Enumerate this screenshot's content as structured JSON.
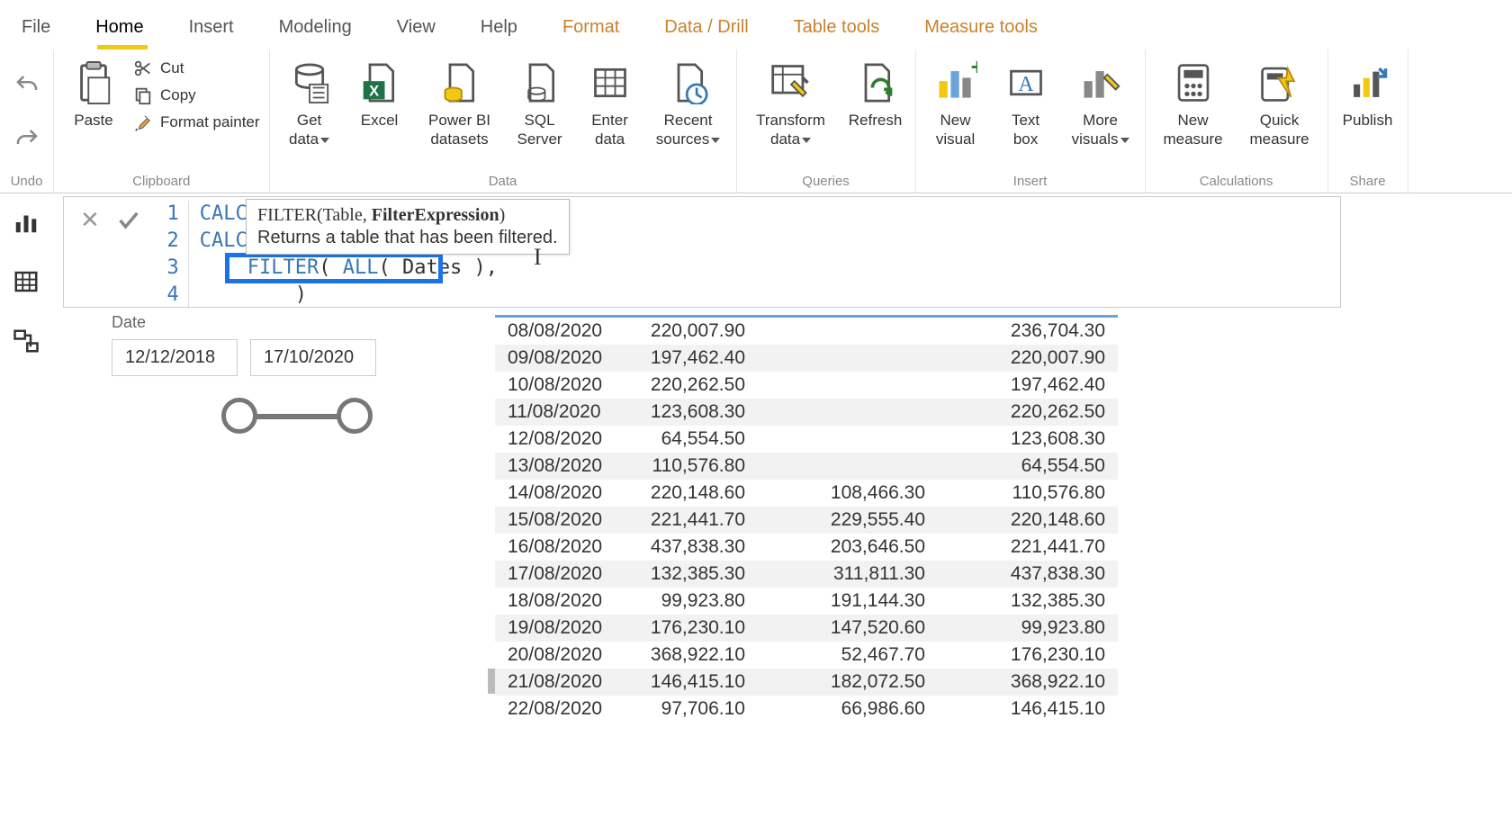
{
  "ribbon": {
    "tabs": [
      "File",
      "Home",
      "Insert",
      "Modeling",
      "View",
      "Help",
      "Format",
      "Data / Drill",
      "Table tools",
      "Measure tools"
    ],
    "active_tab": "Home",
    "groups": {
      "undo": "Undo",
      "clipboard": {
        "label": "Clipboard",
        "paste": "Paste",
        "cut": "Cut",
        "copy": "Copy",
        "format_painter": "Format painter"
      },
      "data": {
        "label": "Data",
        "get_data": "Get\ndata",
        "excel": "Excel",
        "pbi_datasets": "Power BI\ndatasets",
        "sql_server": "SQL\nServer",
        "enter_data": "Enter\ndata",
        "recent_sources": "Recent\nsources"
      },
      "queries": {
        "label": "Queries",
        "transform": "Transform\ndata",
        "refresh": "Refresh"
      },
      "insert": {
        "label": "Insert",
        "new_visual": "New\nvisual",
        "text_box": "Text\nbox",
        "more_visuals": "More\nvisuals"
      },
      "calculations": {
        "label": "Calculations",
        "new_measure": "New\nmeasure",
        "quick_measure": "Quick\nmeasure"
      },
      "share": {
        "label": "Share",
        "publish": "Publish"
      }
    }
  },
  "formula": {
    "lines": {
      "l1": "CALC",
      "l2": "CALC",
      "l3_pre": "    ",
      "l3_func": "FILTER",
      "l3_open": "( ",
      "l3_all": "ALL",
      "l3_args": "( Dates ),",
      "l4": "        )"
    },
    "gutter": [
      "1",
      "2",
      "3",
      "4"
    ]
  },
  "tooltip": {
    "sig_fn": "FILTER",
    "sig_open": "(Table, ",
    "sig_param": "FilterExpression",
    "sig_close": ")",
    "desc": "Returns a table that has been filtered."
  },
  "slicer": {
    "title": "Date",
    "from": "12/12/2018",
    "to": "17/10/2020"
  },
  "table": {
    "rows": [
      {
        "date": "08/08/2020",
        "v1": "220,007.90",
        "v2": "",
        "v3": "236,704.30"
      },
      {
        "date": "09/08/2020",
        "v1": "197,462.40",
        "v2": "",
        "v3": "220,007.90"
      },
      {
        "date": "10/08/2020",
        "v1": "220,262.50",
        "v2": "",
        "v3": "197,462.40"
      },
      {
        "date": "11/08/2020",
        "v1": "123,608.30",
        "v2": "",
        "v3": "220,262.50"
      },
      {
        "date": "12/08/2020",
        "v1": "64,554.50",
        "v2": "",
        "v3": "123,608.30"
      },
      {
        "date": "13/08/2020",
        "v1": "110,576.80",
        "v2": "",
        "v3": "64,554.50"
      },
      {
        "date": "14/08/2020",
        "v1": "220,148.60",
        "v2": "108,466.30",
        "v3": "110,576.80"
      },
      {
        "date": "15/08/2020",
        "v1": "221,441.70",
        "v2": "229,555.40",
        "v3": "220,148.60"
      },
      {
        "date": "16/08/2020",
        "v1": "437,838.30",
        "v2": "203,646.50",
        "v3": "221,441.70"
      },
      {
        "date": "17/08/2020",
        "v1": "132,385.30",
        "v2": "311,811.30",
        "v3": "437,838.30"
      },
      {
        "date": "18/08/2020",
        "v1": "99,923.80",
        "v2": "191,144.30",
        "v3": "132,385.30"
      },
      {
        "date": "19/08/2020",
        "v1": "176,230.10",
        "v2": "147,520.60",
        "v3": "99,923.80"
      },
      {
        "date": "20/08/2020",
        "v1": "368,922.10",
        "v2": "52,467.70",
        "v3": "176,230.10"
      },
      {
        "date": "21/08/2020",
        "v1": "146,415.10",
        "v2": "182,072.50",
        "v3": "368,922.10"
      },
      {
        "date": "22/08/2020",
        "v1": "97,706.10",
        "v2": "66,986.60",
        "v3": "146,415.10"
      }
    ]
  },
  "colors": {
    "accent": "#f2c811",
    "context_tab": "#c8822b",
    "highlight": "#1a73e8"
  }
}
